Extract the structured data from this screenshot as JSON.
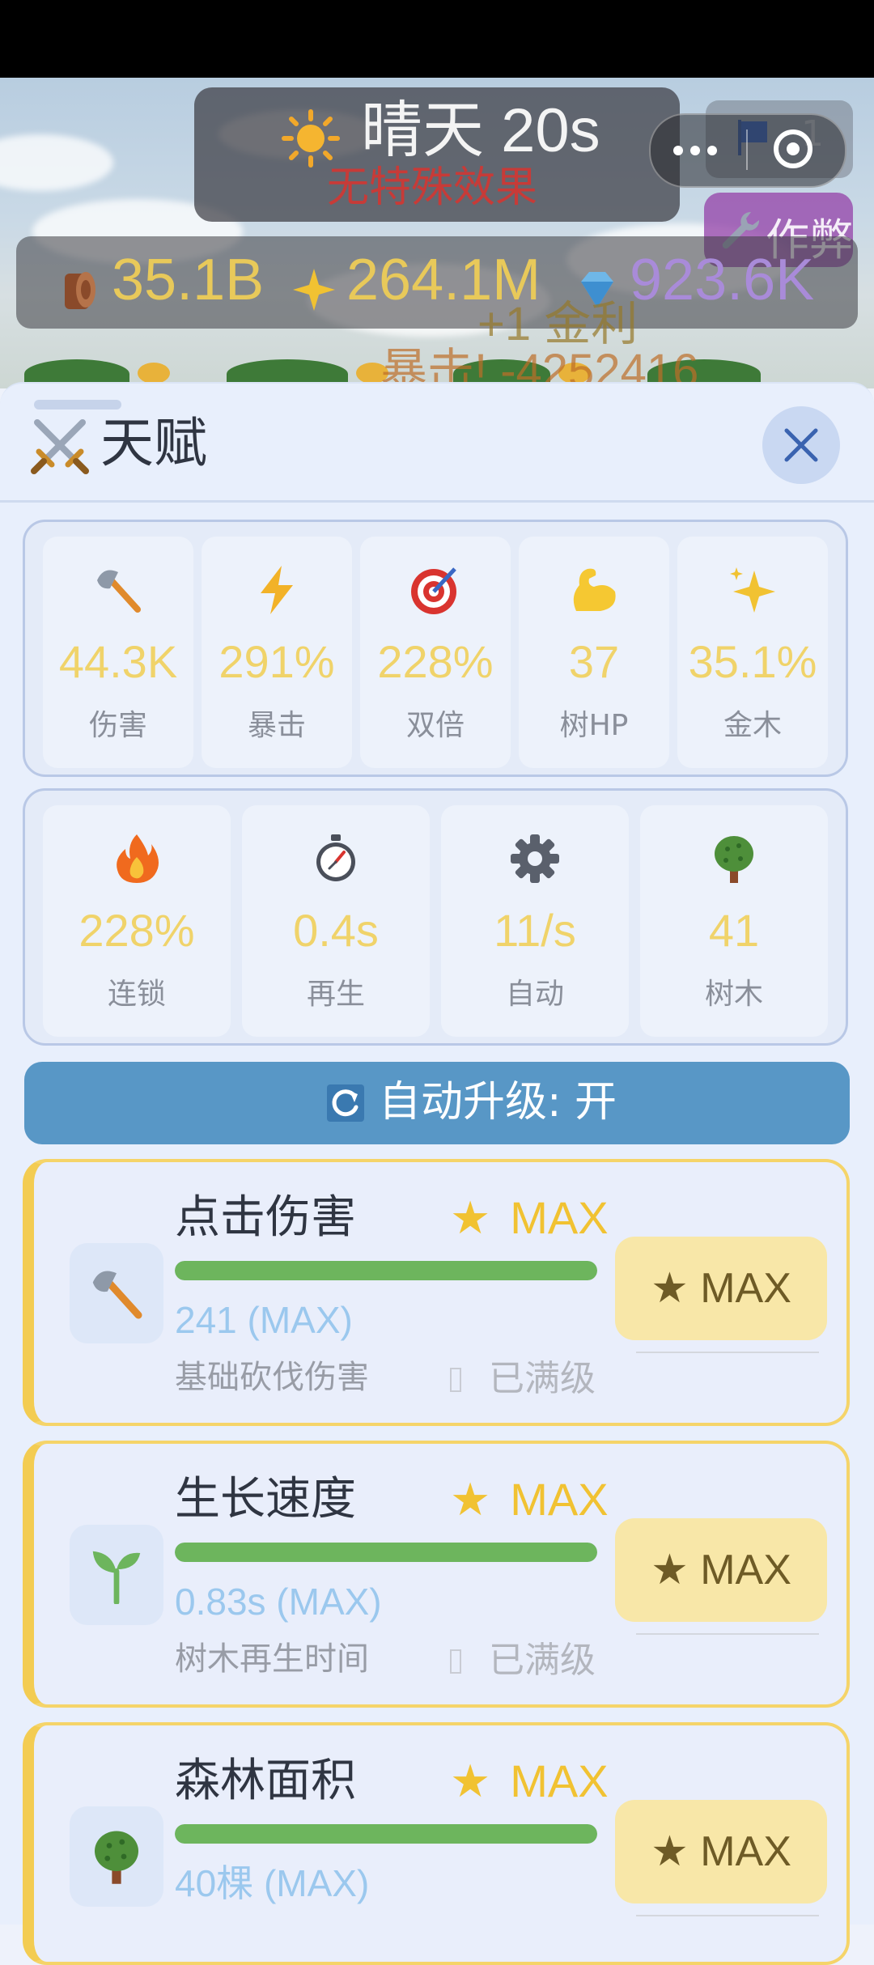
{
  "weather": {
    "label": "晴天 20s",
    "effect": "无特殊效果"
  },
  "top_actions": {
    "flag_count": "1",
    "cheat_label": "作弊"
  },
  "resources": [
    {
      "icon": "log-icon",
      "value": "35.1B"
    },
    {
      "icon": "sparkle-icon",
      "value": "264.1M"
    },
    {
      "icon": "gem-icon",
      "value": "923.6K"
    }
  ],
  "floating": {
    "gold_bonus": "+1 金利",
    "crit": "暴击! -4252416"
  },
  "panel": {
    "title": "天赋"
  },
  "stats_row1": [
    {
      "icon": "axe-icon",
      "value": "44.3K",
      "label": "伤害"
    },
    {
      "icon": "lightning-icon",
      "value": "291%",
      "label": "暴击"
    },
    {
      "icon": "target-icon",
      "value": "228%",
      "label": "双倍"
    },
    {
      "icon": "muscle-icon",
      "value": "37",
      "label": "树HP"
    },
    {
      "icon": "sparkle-icon",
      "value": "35.1%",
      "label": "金木"
    }
  ],
  "stats_row2": [
    {
      "icon": "fire-icon",
      "value": "228%",
      "label": "连锁"
    },
    {
      "icon": "stopwatch-icon",
      "value": "0.4s",
      "label": "再生"
    },
    {
      "icon": "gear-icon",
      "value": "11/s",
      "label": "自动"
    },
    {
      "icon": "tree-icon",
      "value": "41",
      "label": "树木"
    }
  ],
  "auto_upgrade": {
    "label": "自动升级: 开"
  },
  "upgrades": [
    {
      "icon": "axe-icon",
      "name": "点击伤害",
      "star": "★",
      "max_label": "MAX",
      "progress": 1.0,
      "value": "241 (MAX)",
      "desc": "基础砍伐伤害",
      "status": "已满级",
      "button": "★ MAX"
    },
    {
      "icon": "sprout-icon",
      "name": "生长速度",
      "star": "★",
      "max_label": "MAX",
      "progress": 1.0,
      "value": "0.83s (MAX)",
      "desc": "树木再生时间",
      "status": "已满级",
      "button": "★ MAX"
    },
    {
      "icon": "tree-icon",
      "name": "森林面积",
      "star": "★",
      "max_label": "MAX",
      "progress": 1.0,
      "value": "40棵 (MAX)",
      "desc": "",
      "status": "",
      "button": "★ MAX"
    }
  ],
  "colors": {
    "accent_blue": "#5897c6",
    "gold": "#f1c232",
    "progress_green": "#6db55d"
  }
}
